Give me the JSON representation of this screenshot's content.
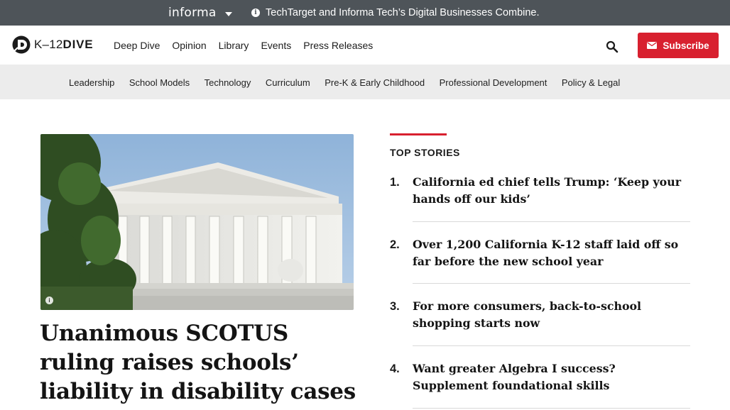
{
  "topbar": {
    "brand": "informa",
    "notice": "TechTarget and Informa Tech’s Digital Businesses Combine."
  },
  "header": {
    "logo_prefix": "K–12",
    "logo_suffix": "DIVE",
    "nav": [
      "Deep Dive",
      "Opinion",
      "Library",
      "Events",
      "Press Releases"
    ],
    "subscribe_label": "Subscribe"
  },
  "subnav": [
    "Leadership",
    "School Models",
    "Technology",
    "Curriculum",
    "Pre-K & Early Childhood",
    "Professional Development",
    "Policy & Legal"
  ],
  "hero": {
    "title": "Unanimous SCOTUS ruling raises schools’ liability in disability cases",
    "image_alt": "Supreme Court building"
  },
  "top_stories": {
    "label": "TOP STORIES",
    "items": [
      {
        "num": "1.",
        "title": "California ed chief tells Trump: ‘Keep your hands off our kids’"
      },
      {
        "num": "2.",
        "title": "Over 1,200 California K-12 staff laid off so far before the new school year"
      },
      {
        "num": "3.",
        "title": "For more consumers, back-to-school shopping starts now"
      },
      {
        "num": "4.",
        "title": "Want greater Algebra I success? Supplement foundational skills"
      }
    ]
  },
  "colors": {
    "accent": "#d8202f",
    "topbar": "#4e5459",
    "subnav": "#ececec"
  }
}
